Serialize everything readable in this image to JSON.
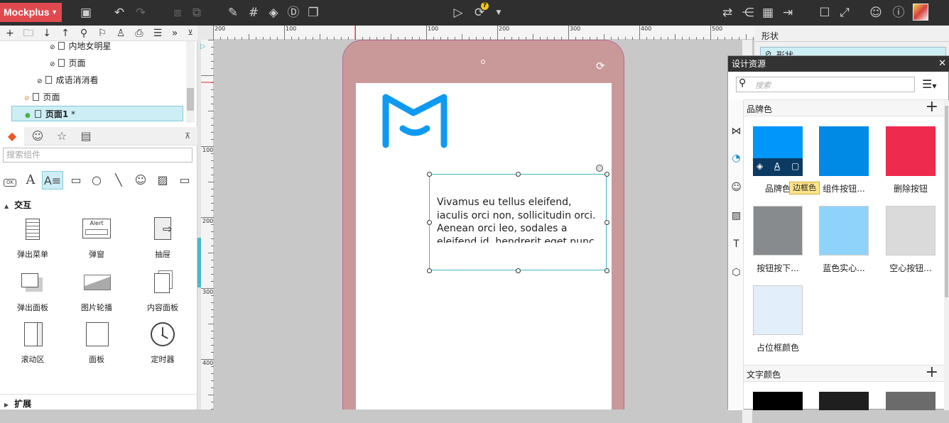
{
  "app": {
    "logo": "Mockplus"
  },
  "toolbar": {
    "icons": [
      "save-icon",
      "undo-icon",
      "redo-icon",
      "crop-icon",
      "group-icon",
      "brush-icon",
      "grid-icon",
      "fill-icon",
      "d-circle-icon",
      "export-icon",
      "play-icon",
      "sync-icon",
      "swap-icon",
      "share-icon",
      "qr-icon",
      "exit-icon",
      "window-icon",
      "fullscreen-icon",
      "team-icon",
      "help-icon",
      "avatar"
    ],
    "badge": "?"
  },
  "tree": {
    "items": [
      {
        "label": "内地女明星"
      },
      {
        "label": "页面"
      },
      {
        "label": "成语消消看"
      },
      {
        "label": "页面"
      },
      {
        "label": "页面1",
        "suffix": "*"
      }
    ]
  },
  "components": {
    "search_placeholder": "搜索组件",
    "section_interact": "交互",
    "section_extend": "扩展",
    "alert_text": "Alert",
    "items": [
      {
        "label": "弹出菜单"
      },
      {
        "label": "弹窗"
      },
      {
        "label": "抽屉"
      },
      {
        "label": "弹出面板"
      },
      {
        "label": "图片轮播"
      },
      {
        "label": "内容面板"
      },
      {
        "label": "滚动区"
      },
      {
        "label": "面板"
      },
      {
        "label": "定时器"
      }
    ]
  },
  "ruler": {
    "h_labels": [
      "200",
      "100",
      "100",
      "200",
      "300",
      "400",
      "500"
    ],
    "v_labels": [
      "100",
      "200",
      "300",
      "400"
    ]
  },
  "canvas": {
    "text": "Vivamus eu tellus eleifend, iaculis orci non, sollicitudin orci. Aenean orci leo, sodales a eleifend id, hendrerit eget nunc. Quisque tellus"
  },
  "right_panel": {
    "title": "形状",
    "sub": "形状"
  },
  "resources": {
    "title": "设计资源",
    "search_placeholder": "搜索",
    "brand_section": "品牌色",
    "text_section": "文字颜色",
    "tooltip": "边框色",
    "swatches": [
      {
        "label": "品牌色",
        "color": "#0096fa"
      },
      {
        "label": "组件按钮...",
        "color": "#0089e5"
      },
      {
        "label": "删除按钮",
        "color": "#ee2a4e"
      },
      {
        "label": "按钮按下...",
        "color": "#888b8d"
      },
      {
        "label": "蓝色实心...",
        "color": "#8fd3fb"
      },
      {
        "label": "空心按钮...",
        "color": "#dadada"
      },
      {
        "label": "占位框颜色",
        "color": "#e2eef9"
      }
    ],
    "text_swatches": [
      {
        "color": "#000000"
      },
      {
        "color": "#1f1f1f"
      },
      {
        "color": "#6b6b6b"
      }
    ]
  }
}
